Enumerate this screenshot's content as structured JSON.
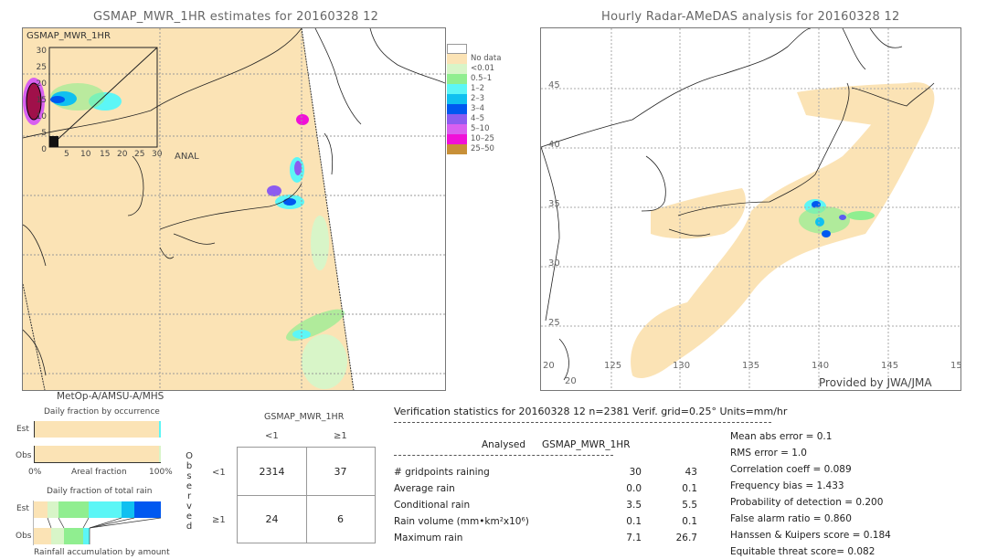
{
  "left_panel": {
    "title": "GSMAP_MWR_1HR estimates for 20160328 12",
    "inset_label": "GSMAP_MWR_1HR",
    "inset_x_label": "ANAL",
    "inset_y_ticks": [
      "0",
      "5",
      "10",
      "15",
      "20",
      "25",
      "30"
    ],
    "inset_x_ticks": [
      "5",
      "10",
      "15",
      "20",
      "25",
      "30"
    ],
    "satellite": "MetOp-A/AMSU-A/MHS"
  },
  "right_panel": {
    "title": "Hourly Radar-AMeDAS analysis for 20160328 12",
    "lat_labels": [
      "45",
      "40",
      "35",
      "30",
      "25",
      "20"
    ],
    "lon_labels": [
      "20",
      "125",
      "130",
      "135",
      "140",
      "145",
      "15"
    ],
    "credit": "Provided by JWA/JMA"
  },
  "legend": {
    "items": [
      {
        "label": "",
        "color": "#ffffff"
      },
      {
        "label": "No data",
        "color": "#fbe3b5"
      },
      {
        "label": "<0.01",
        "color": "#d8f5c8"
      },
      {
        "label": "0.5–1",
        "color": "#90ee90"
      },
      {
        "label": "1–2",
        "color": "#5cf6f6"
      },
      {
        "label": "2–3",
        "color": "#10c0f0"
      },
      {
        "label": "3–4",
        "color": "#0058f0"
      },
      {
        "label": "4–5",
        "color": "#8c5cf0"
      },
      {
        "label": "5–10",
        "color": "#d860f0"
      },
      {
        "label": "10–25",
        "color": "#f010d8"
      },
      {
        "label": "25–50",
        "color": "#c89038"
      }
    ]
  },
  "occurrence_chart": {
    "title": "Daily fraction by occurrence",
    "rows": [
      "Est",
      "Obs"
    ],
    "x_left": "0%",
    "x_mid": "Areal fraction",
    "x_right": "100%"
  },
  "total_rain_chart": {
    "title": "Daily fraction of total rain",
    "rows": [
      "Est",
      "Obs"
    ],
    "footer": "Rainfall accumulation by amount"
  },
  "contingency": {
    "header": "GSMAP_MWR_1HR",
    "col_labels": [
      "<1",
      "≥1"
    ],
    "row_labels": [
      "<1",
      "≥1"
    ],
    "side_label": [
      "O",
      "b",
      "s",
      "e",
      "r",
      "v",
      "e",
      "d"
    ],
    "cells": [
      [
        "2314",
        "37"
      ],
      [
        "24",
        "6"
      ]
    ]
  },
  "verification": {
    "header": "Verification statistics for 20160328 12   n=2381   Verif. grid=0.25°   Units=mm/hr",
    "col_analysed": "Analysed",
    "col_model": "GSMAP_MWR_1HR",
    "rows": [
      {
        "label": "# gridpoints raining",
        "analysed": "30",
        "model": "43"
      },
      {
        "label": "Average rain",
        "analysed": "0.0",
        "model": "0.1"
      },
      {
        "label": "Conditional rain",
        "analysed": "3.5",
        "model": "5.5"
      },
      {
        "label": "Rain volume (mm•km²x10⁶)",
        "analysed": "0.1",
        "model": "0.1"
      },
      {
        "label": "Maximum rain",
        "analysed": "7.1",
        "model": "26.7"
      }
    ],
    "scores": [
      "Mean abs error = 0.1",
      "RMS error = 1.0",
      "Correlation coeff = 0.089",
      "Frequency bias = 1.433",
      "Probability of detection = 0.200",
      "False alarm ratio = 0.860",
      "Hanssen & Kuipers score = 0.184",
      "Equitable threat score= 0.082"
    ]
  }
}
